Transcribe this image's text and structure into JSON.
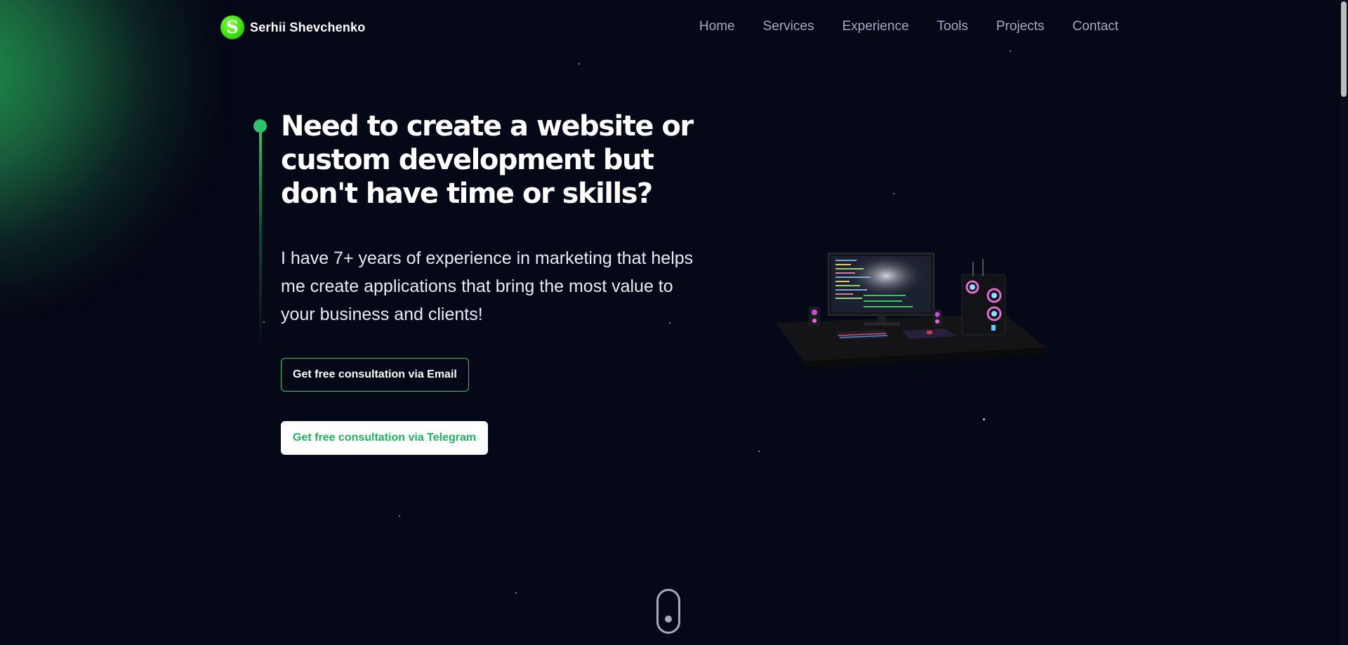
{
  "brand": {
    "logo_letter": "S",
    "name": "Serhii Shevchenko"
  },
  "nav": {
    "items": [
      {
        "label": "Home"
      },
      {
        "label": "Services"
      },
      {
        "label": "Experience"
      },
      {
        "label": "Tools"
      },
      {
        "label": "Projects"
      },
      {
        "label": "Contact"
      }
    ]
  },
  "hero": {
    "headline": "Need to create a website or custom development but don't have time or skills?",
    "subtext": "I have 7+ years of experience in marketing that helps me create applications that bring the most value to your business and clients!",
    "email_button": "Get free consultation via Email",
    "telegram_button": "Get free consultation via Telegram"
  },
  "icons": {
    "logo": "logo-s-icon",
    "scroll": "mouse-scroll-icon"
  },
  "colors": {
    "background": "#050816",
    "accent": "#2fc46a",
    "nav_text": "#aaa6c3",
    "logo_green": "#3ee014"
  }
}
